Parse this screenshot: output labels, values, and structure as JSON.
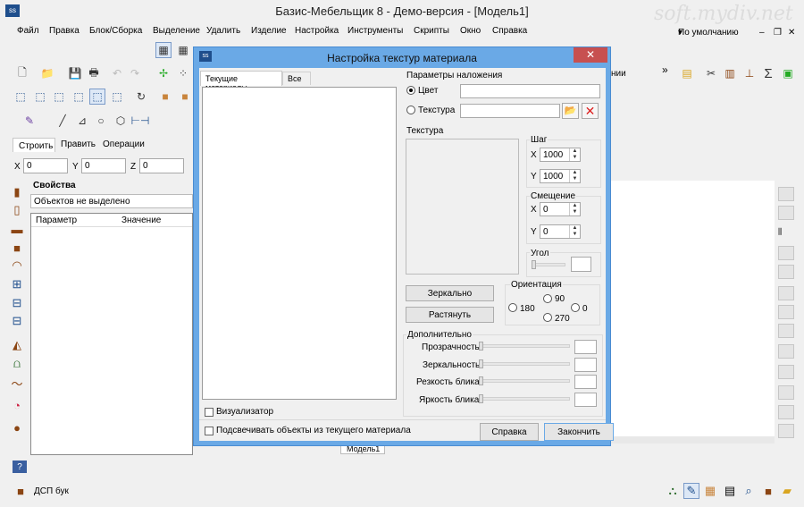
{
  "app": {
    "title": "Базис-Мебельщик 8 - Демо-версия - [Модель1]",
    "watermark": "soft.mydiv.net"
  },
  "menu": [
    "Файл",
    "Правка",
    "Блок/Сборка",
    "Выделение",
    "Удалить",
    "Изделие",
    "Настройка",
    "Инструменты",
    "Скрипты",
    "Окно",
    "Справка"
  ],
  "view_select": "По умолчанию",
  "toolbar_right_label": "нии",
  "tabs": {
    "build": "Строить",
    "edit": "Править",
    "ops": "Операции"
  },
  "coords": {
    "x_label": "X",
    "x_val": "0",
    "y_label": "Y",
    "y_val": "0",
    "z_label": "Z",
    "z_val": "0"
  },
  "properties": {
    "title": "Свойства",
    "selection": "Объектов не выделено",
    "col_param": "Параметр",
    "col_value": "Значение"
  },
  "bottom_tab": "Модель1",
  "status": {
    "material": "ДСП бук"
  },
  "dialog": {
    "title": "Настройка текстур материала",
    "close": "✕",
    "tab_current": "Текущие материалы",
    "tab_all": "Все",
    "visualizer": "Визуализатор",
    "highlight": "Подсвечивать объекты из текущего материала",
    "mapping_title": "Параметры наложения",
    "color_label": "Цвет",
    "texture_radio": "Текстура",
    "texture_group": "Текстура",
    "step": "Шаг",
    "step_x_label": "X",
    "step_x": "1000",
    "step_y_label": "Y",
    "step_y": "1000",
    "offset": "Смещение",
    "off_x_label": "X",
    "off_x": "0",
    "off_y_label": "Y",
    "off_y": "0",
    "angle": "Угол",
    "mirror_btn": "Зеркально",
    "stretch_btn": "Растянуть",
    "orientation": "Ориентация",
    "o90": "90",
    "o180": "180",
    "o0": "0",
    "o270": "270",
    "extra": "Дополнительно",
    "transparency": "Прозрачность",
    "reflect": "Зеркальность",
    "sharp": "Резкость блика",
    "bright": "Яркость блика",
    "help_btn": "Справка",
    "finish_btn": "Закончить"
  }
}
